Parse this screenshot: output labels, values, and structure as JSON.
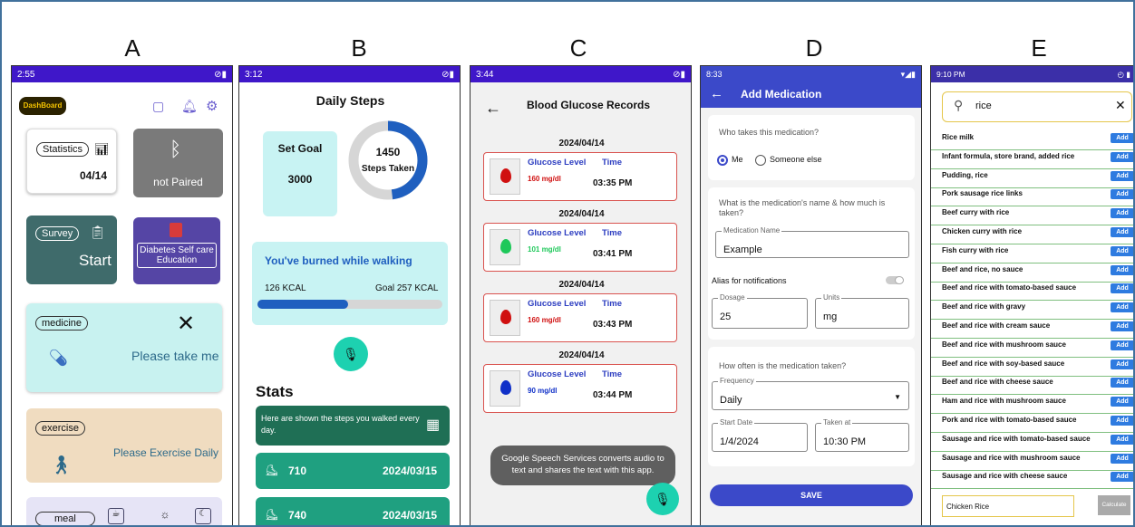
{
  "labels": {
    "a": "A",
    "b": "B",
    "c": "C",
    "d": "D",
    "e": "E"
  },
  "A": {
    "time": "2:55",
    "dashboard": "DashBoard",
    "statistics": "Statistics",
    "date": "04/14",
    "not_paired": "not Paired",
    "survey": "Survey",
    "start": "Start",
    "edu": "Diabetes Self care Education",
    "medicine": "medicine",
    "take": "Please take me",
    "exercise": "exercise",
    "exercise_msg": "Please Exercise Daily",
    "meal": "meal"
  },
  "B": {
    "time": "3:12",
    "title": "Daily Steps",
    "set_goal": "Set Goal",
    "goal": "3000",
    "steps": "1450",
    "steps_taken": "Steps Taken",
    "steps_fraction": 0.48,
    "burn": "You've burned while walking",
    "kcal": "126 KCAL",
    "goal_kcal": "Goal 257 KCAL",
    "burn_fraction": 0.49,
    "stats": "Stats",
    "info": "Here are shown the steps you walked every day.",
    "rows": [
      {
        "steps": "710",
        "date": "2024/03/15"
      },
      {
        "steps": "740",
        "date": "2024/03/15"
      }
    ]
  },
  "C": {
    "time": "3:44",
    "title": "Blood Glucose Records",
    "records": [
      {
        "date": "2024/04/14",
        "label": "Glucose Level",
        "time_label": "Time",
        "value": "160 mg/dl",
        "time": "03:35 PM",
        "color": "#d01010"
      },
      {
        "date": "2024/04/14",
        "label": "Glucose Level",
        "time_label": "Time",
        "value": "101 mg/dl",
        "time": "03:41 PM",
        "color": "#1ec85a"
      },
      {
        "date": "2024/04/14",
        "label": "Glucose Level",
        "time_label": "Time",
        "value": "160 mg/dl",
        "time": "03:43 PM",
        "color": "#d01010"
      },
      {
        "date": "2024/04/14",
        "label": "Glucose Level",
        "time_label": "Time",
        "value": "90 mg/dl",
        "time": "03:44 PM",
        "color": "#1030c8"
      }
    ],
    "toast": "Google Speech Services converts audio to text and shares the text with this app."
  },
  "D": {
    "time": "8:33",
    "title": "Add Medication",
    "who": "Who takes this medication?",
    "me": "Me",
    "someone": "Someone else",
    "name_q": "What is the medication's name & how much is taken?",
    "med_name_label": "Medication Name",
    "med_name": "Example",
    "alias": "Alias for notifications",
    "dosage_label": "Dosage",
    "dosage": "25",
    "units_label": "Units",
    "units": "mg",
    "often": "How often is the medication taken?",
    "freq_label": "Frequency",
    "freq": "Daily",
    "start_label": "Start Date",
    "start": "1/4/2024",
    "taken_label": "Taken at",
    "taken": "10:30 PM",
    "save": "SAVE"
  },
  "E": {
    "time": "9:10 PM",
    "search": "rice",
    "add": "Add",
    "foods": [
      "Rice milk",
      "Infant formula, store brand, added rice",
      "Pudding, rice",
      "Pork sausage rice links",
      "Beef curry with rice",
      "Chicken curry with rice",
      "Fish curry with rice",
      "Beef and rice, no sauce",
      "Beef and rice with tomato-based sauce",
      "Beef and rice with gravy",
      "Beef and rice with cream sauce",
      "Beef and rice with mushroom sauce",
      "Beef and rice with soy-based sauce",
      "Beef and rice with cheese sauce",
      "Ham and rice with mushroom sauce",
      "Pork and rice with tomato-based sauce",
      "Sausage and rice with tomato-based sauce",
      "Sausage and rice with mushroom sauce",
      "Sausage and rice with cheese sauce"
    ],
    "selected": "Chicken Rice",
    "calculate": "Calculate"
  }
}
